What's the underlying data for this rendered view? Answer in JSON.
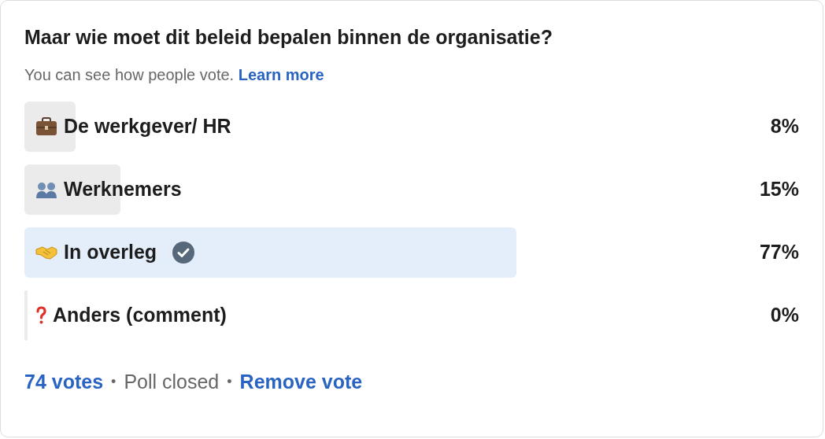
{
  "question": "Maar wie moet dit beleid bepalen binnen de organisatie?",
  "visibility_note": "You can see how people vote.",
  "learn_more_link": "Learn more",
  "options": [
    {
      "kind": "briefcase",
      "label": "De werkgever/ HR",
      "percent": "8%",
      "selected": false
    },
    {
      "kind": "people",
      "label": "Werknemers",
      "percent": "15%",
      "selected": false
    },
    {
      "kind": "handshake",
      "label": "In overleg",
      "percent": "77%",
      "selected": true
    },
    {
      "kind": "question",
      "label": "Anders (comment)",
      "percent": "0%",
      "selected": false
    }
  ],
  "footer": {
    "votes": "74 votes",
    "separator_1": "•",
    "status": "Poll closed",
    "separator_2": "•",
    "remove_vote": "Remove vote"
  }
}
